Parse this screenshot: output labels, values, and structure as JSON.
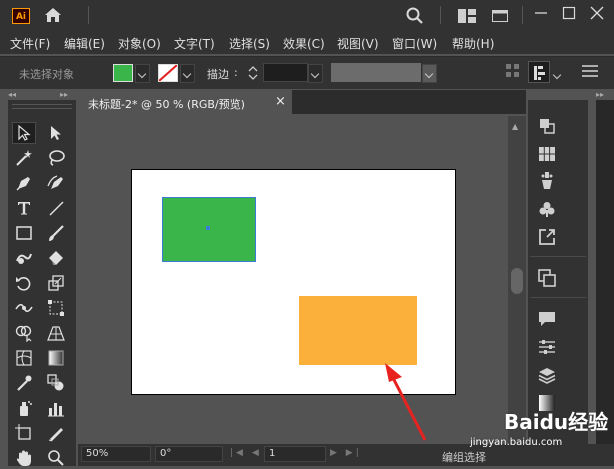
{
  "app": {
    "logo": "Ai"
  },
  "menu": [
    "文件(F)",
    "编辑(E)",
    "对象(O)",
    "文字(T)",
    "选择(S)",
    "效果(C)",
    "视图(V)",
    "窗口(W)",
    "帮助(H)"
  ],
  "control": {
    "selection": "未选择对象",
    "stroke_label": "描边",
    "fill_color": "#39b54a"
  },
  "document": {
    "tab_title": "未标题-2* @ 50 % (RGB/预览)",
    "close": "×"
  },
  "artwork": {
    "green_rect_color": "#39b54a",
    "orange_rect_color": "#fbb03b",
    "arrow_color": "#e8231f"
  },
  "status": {
    "zoom": "50%",
    "rotation": "0°",
    "artboard": "1",
    "tool_name": "编组选择"
  },
  "watermark": {
    "brand": "Baidu经验",
    "url": "jingyan.baidu.com"
  }
}
